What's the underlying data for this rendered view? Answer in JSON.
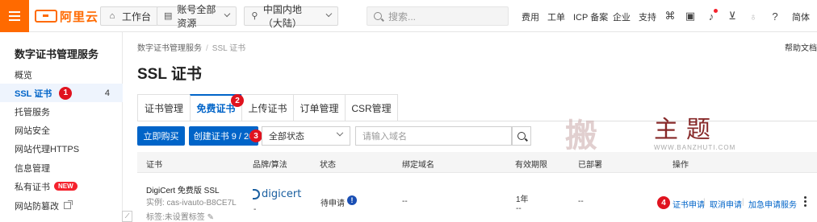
{
  "topbar": {
    "logo_text": "阿里云",
    "workbench": "工作台",
    "account_resources": "账号全部资源",
    "region": "中国内地（大陆）",
    "search_placeholder": "搜索...",
    "nav": [
      "费用",
      "工单",
      "ICP 备案",
      "企业",
      "支持"
    ],
    "lang": "简体",
    "icons": [
      "terminal-icon",
      "image-icon",
      "bell-icon",
      "cart-icon",
      "bulb-icon",
      "help-icon"
    ]
  },
  "sidebar": {
    "title": "数字证书管理服务",
    "items": [
      {
        "label": "概览"
      },
      {
        "label": "SSL 证书",
        "count": "4",
        "active": true,
        "marker": "1"
      },
      {
        "label": "托管服务"
      },
      {
        "label": "网站安全"
      },
      {
        "label": "网站代理HTTPS"
      },
      {
        "label": "信息管理"
      },
      {
        "label": "私有证书",
        "badge": "NEW"
      },
      {
        "label": "网站防篡改"
      }
    ]
  },
  "main": {
    "breadcrumb": [
      "数字证书管理服务",
      "SSL 证书"
    ],
    "help_link": "帮助文档",
    "title": "SSL 证书",
    "tabs": [
      {
        "label": "证书管理"
      },
      {
        "label": "免费证书",
        "active": true,
        "marker": "2"
      },
      {
        "label": "上传证书"
      },
      {
        "label": "订单管理"
      },
      {
        "label": "CSR管理"
      }
    ],
    "toolbar": {
      "buy_now": "立即购买",
      "create_cert": "创建证书 9 / 20",
      "create_marker": "3",
      "status_select": "全部状态",
      "domain_placeholder": "请输入域名"
    },
    "table": {
      "headers": [
        "证书",
        "品牌/算法",
        "状态",
        "绑定域名",
        "有效期限",
        "已部署",
        "操作"
      ],
      "rows": [
        {
          "cert_name": "DigiCert 免费版 SSL",
          "instance": "实例: cas-ivauto-B8CE7L",
          "tags": "标签:未设置标签",
          "brand": "digicert",
          "brand_sub": "-",
          "status": "待申请",
          "domain": "--",
          "validity": "1年",
          "validity_sub": "--",
          "deployed": "--",
          "ops_marker": "4",
          "ops": [
            "证书申请",
            "取消申请",
            "加急申请服务"
          ]
        }
      ]
    }
  },
  "watermark": {
    "logo_char": "搬",
    "text": "主题",
    "url": "WWW.BANZHUTI.COM"
  },
  "colors": {
    "brand_orange": "#ff6a00",
    "primary_blue": "#0064c8",
    "marker_red": "#e0131f"
  }
}
